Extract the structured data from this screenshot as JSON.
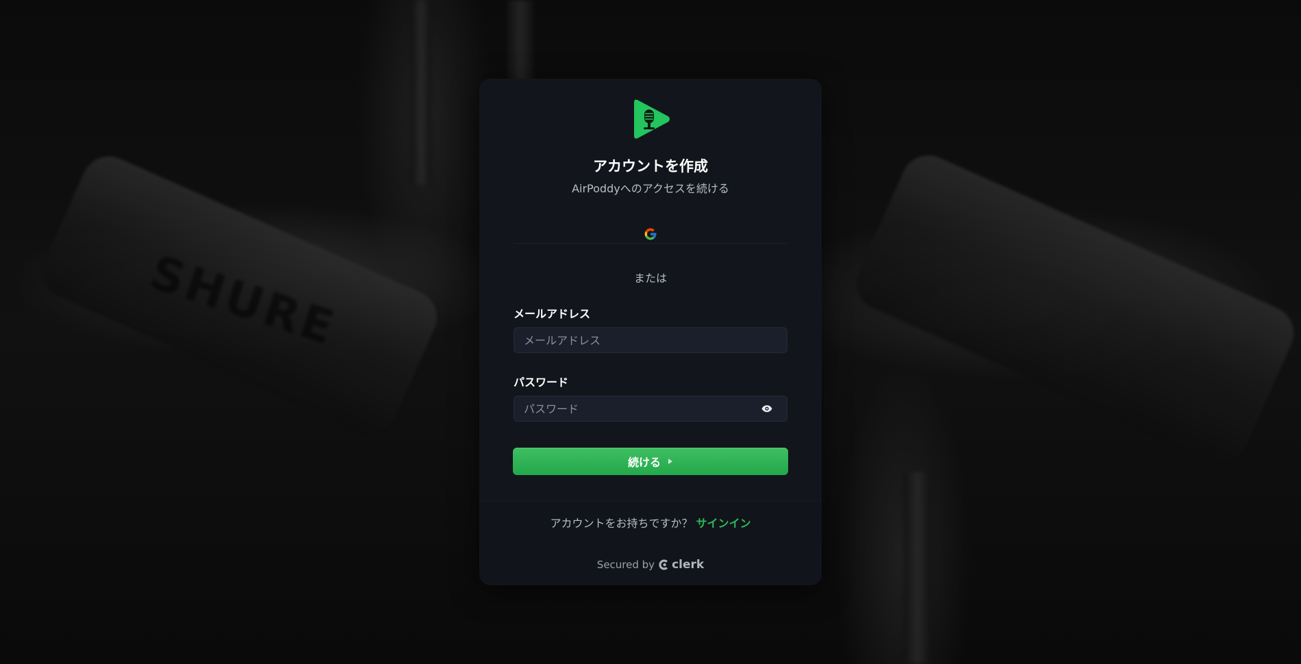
{
  "app": {
    "title": "アカウントを作成",
    "subtitle": "AirPoddyへのアクセスを続ける",
    "brand_color": "#22c55e"
  },
  "background": {
    "brand_text": "SHURE"
  },
  "social": {
    "google_icon": "google-g-icon"
  },
  "divider": {
    "label": "または"
  },
  "form": {
    "email_label": "メールアドレス",
    "email_placeholder": "メールアドレス",
    "email_value": "",
    "password_label": "パスワード",
    "password_placeholder": "パスワード",
    "password_value": "",
    "show_password_icon": "eye-icon",
    "submit_label": "続ける",
    "submit_icon": "triangle-right-icon"
  },
  "footer": {
    "prompt": "アカウントをお持ちですか？",
    "signin_link": "サインイン",
    "secured_by": "Secured by",
    "provider": "clerk"
  }
}
